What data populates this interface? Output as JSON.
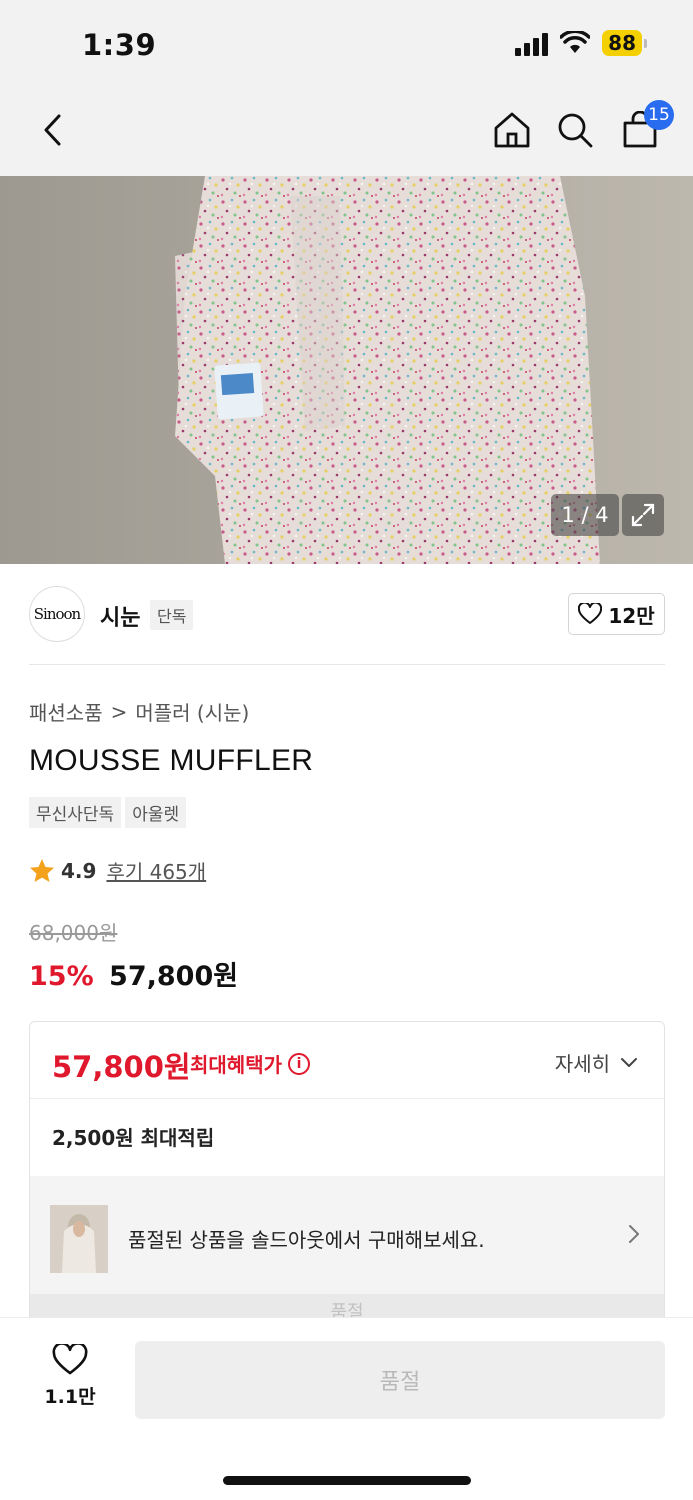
{
  "status_bar": {
    "time": "1:39",
    "battery": "88"
  },
  "nav": {
    "cart_count": "15"
  },
  "gallery": {
    "counter": "1 / 4"
  },
  "brand": {
    "logo_text": "Sinoon",
    "name": "시눈",
    "tag": "단독",
    "likes": "12만"
  },
  "breadcrumb": {
    "category": "패션소품",
    "separator": ">",
    "subcategory": "머플러 (시눈)"
  },
  "product": {
    "title": "MOUSSE MUFFLER",
    "tags": [
      "무신사단독",
      "아울렛"
    ],
    "rating": "4.9",
    "reviews": "후기 465개",
    "original_price": "68,000원",
    "discount": "15%",
    "sale_price": "57,800원"
  },
  "benefit": {
    "price": "57,800원",
    "label": "최대혜택가",
    "detail_label": "자세히",
    "points": "2,500원 최대적립",
    "soldout_message": "품절된 상품을 솔드아웃에서 구매해보세요.",
    "soldout_strip": "품절"
  },
  "bottom_bar": {
    "like_count": "1.1만",
    "buy_label": "품절"
  },
  "colors": {
    "accent_red": "#e0182d",
    "badge_blue": "#2a6cf0",
    "battery_yellow": "#f5d000"
  }
}
